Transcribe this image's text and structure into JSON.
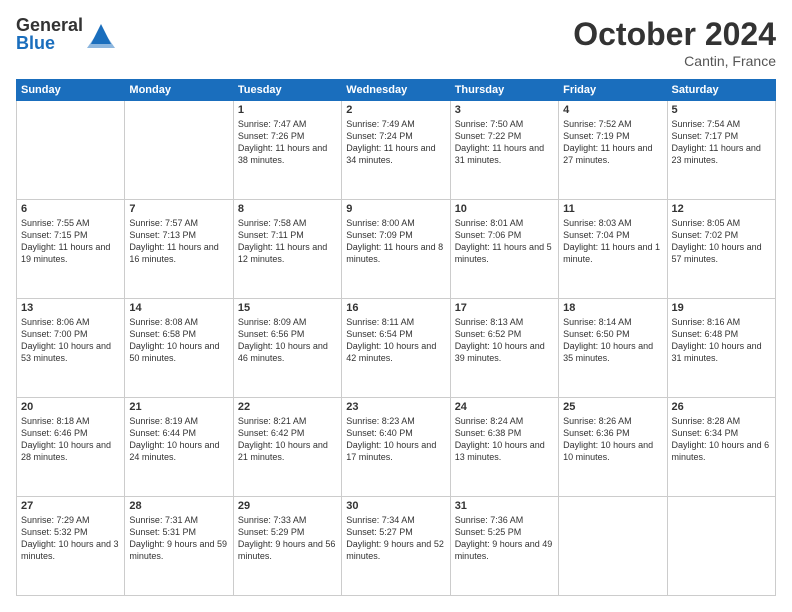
{
  "header": {
    "logo_general": "General",
    "logo_blue": "Blue",
    "month": "October 2024",
    "location": "Cantin, France"
  },
  "days_of_week": [
    "Sunday",
    "Monday",
    "Tuesday",
    "Wednesday",
    "Thursday",
    "Friday",
    "Saturday"
  ],
  "weeks": [
    [
      {
        "day": "",
        "content": ""
      },
      {
        "day": "",
        "content": ""
      },
      {
        "day": "1",
        "content": "Sunrise: 7:47 AM\nSunset: 7:26 PM\nDaylight: 11 hours and 38 minutes."
      },
      {
        "day": "2",
        "content": "Sunrise: 7:49 AM\nSunset: 7:24 PM\nDaylight: 11 hours and 34 minutes."
      },
      {
        "day": "3",
        "content": "Sunrise: 7:50 AM\nSunset: 7:22 PM\nDaylight: 11 hours and 31 minutes."
      },
      {
        "day": "4",
        "content": "Sunrise: 7:52 AM\nSunset: 7:19 PM\nDaylight: 11 hours and 27 minutes."
      },
      {
        "day": "5",
        "content": "Sunrise: 7:54 AM\nSunset: 7:17 PM\nDaylight: 11 hours and 23 minutes."
      }
    ],
    [
      {
        "day": "6",
        "content": "Sunrise: 7:55 AM\nSunset: 7:15 PM\nDaylight: 11 hours and 19 minutes."
      },
      {
        "day": "7",
        "content": "Sunrise: 7:57 AM\nSunset: 7:13 PM\nDaylight: 11 hours and 16 minutes."
      },
      {
        "day": "8",
        "content": "Sunrise: 7:58 AM\nSunset: 7:11 PM\nDaylight: 11 hours and 12 minutes."
      },
      {
        "day": "9",
        "content": "Sunrise: 8:00 AM\nSunset: 7:09 PM\nDaylight: 11 hours and 8 minutes."
      },
      {
        "day": "10",
        "content": "Sunrise: 8:01 AM\nSunset: 7:06 PM\nDaylight: 11 hours and 5 minutes."
      },
      {
        "day": "11",
        "content": "Sunrise: 8:03 AM\nSunset: 7:04 PM\nDaylight: 11 hours and 1 minute."
      },
      {
        "day": "12",
        "content": "Sunrise: 8:05 AM\nSunset: 7:02 PM\nDaylight: 10 hours and 57 minutes."
      }
    ],
    [
      {
        "day": "13",
        "content": "Sunrise: 8:06 AM\nSunset: 7:00 PM\nDaylight: 10 hours and 53 minutes."
      },
      {
        "day": "14",
        "content": "Sunrise: 8:08 AM\nSunset: 6:58 PM\nDaylight: 10 hours and 50 minutes."
      },
      {
        "day": "15",
        "content": "Sunrise: 8:09 AM\nSunset: 6:56 PM\nDaylight: 10 hours and 46 minutes."
      },
      {
        "day": "16",
        "content": "Sunrise: 8:11 AM\nSunset: 6:54 PM\nDaylight: 10 hours and 42 minutes."
      },
      {
        "day": "17",
        "content": "Sunrise: 8:13 AM\nSunset: 6:52 PM\nDaylight: 10 hours and 39 minutes."
      },
      {
        "day": "18",
        "content": "Sunrise: 8:14 AM\nSunset: 6:50 PM\nDaylight: 10 hours and 35 minutes."
      },
      {
        "day": "19",
        "content": "Sunrise: 8:16 AM\nSunset: 6:48 PM\nDaylight: 10 hours and 31 minutes."
      }
    ],
    [
      {
        "day": "20",
        "content": "Sunrise: 8:18 AM\nSunset: 6:46 PM\nDaylight: 10 hours and 28 minutes."
      },
      {
        "day": "21",
        "content": "Sunrise: 8:19 AM\nSunset: 6:44 PM\nDaylight: 10 hours and 24 minutes."
      },
      {
        "day": "22",
        "content": "Sunrise: 8:21 AM\nSunset: 6:42 PM\nDaylight: 10 hours and 21 minutes."
      },
      {
        "day": "23",
        "content": "Sunrise: 8:23 AM\nSunset: 6:40 PM\nDaylight: 10 hours and 17 minutes."
      },
      {
        "day": "24",
        "content": "Sunrise: 8:24 AM\nSunset: 6:38 PM\nDaylight: 10 hours and 13 minutes."
      },
      {
        "day": "25",
        "content": "Sunrise: 8:26 AM\nSunset: 6:36 PM\nDaylight: 10 hours and 10 minutes."
      },
      {
        "day": "26",
        "content": "Sunrise: 8:28 AM\nSunset: 6:34 PM\nDaylight: 10 hours and 6 minutes."
      }
    ],
    [
      {
        "day": "27",
        "content": "Sunrise: 7:29 AM\nSunset: 5:32 PM\nDaylight: 10 hours and 3 minutes."
      },
      {
        "day": "28",
        "content": "Sunrise: 7:31 AM\nSunset: 5:31 PM\nDaylight: 9 hours and 59 minutes."
      },
      {
        "day": "29",
        "content": "Sunrise: 7:33 AM\nSunset: 5:29 PM\nDaylight: 9 hours and 56 minutes."
      },
      {
        "day": "30",
        "content": "Sunrise: 7:34 AM\nSunset: 5:27 PM\nDaylight: 9 hours and 52 minutes."
      },
      {
        "day": "31",
        "content": "Sunrise: 7:36 AM\nSunset: 5:25 PM\nDaylight: 9 hours and 49 minutes."
      },
      {
        "day": "",
        "content": ""
      },
      {
        "day": "",
        "content": ""
      }
    ]
  ]
}
